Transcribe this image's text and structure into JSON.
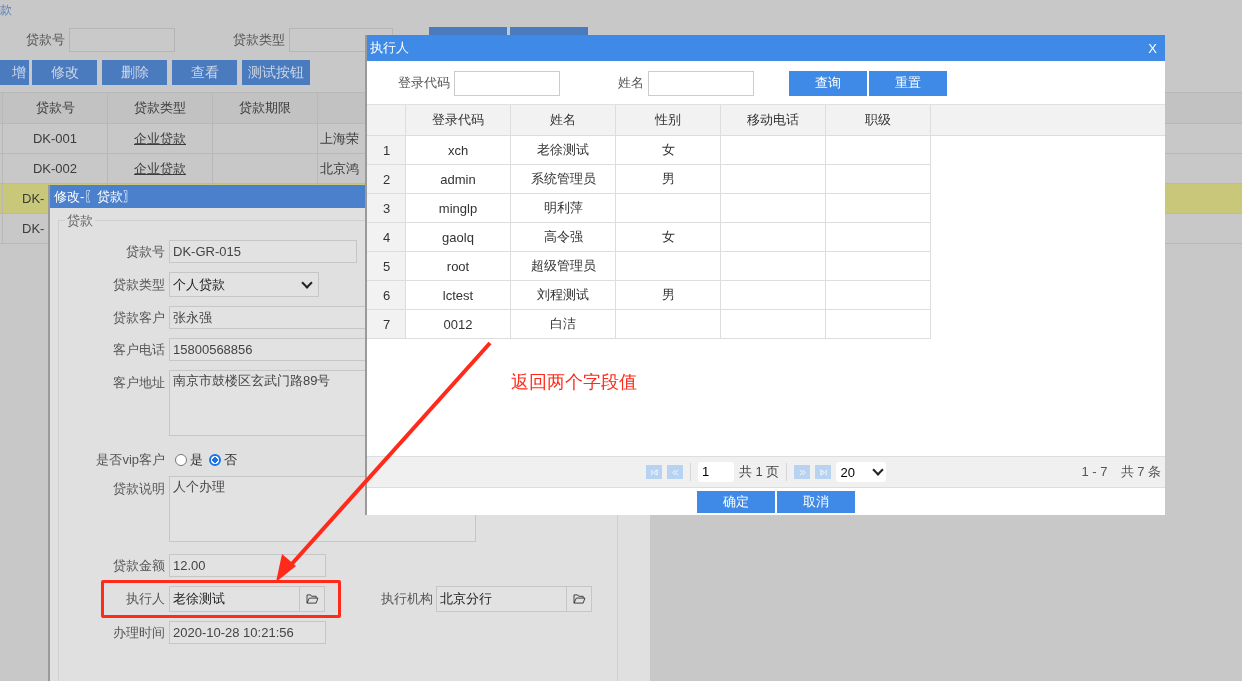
{
  "background_page": {
    "title": "款",
    "search_fields": [
      {
        "label": "贷款号"
      },
      {
        "label": "贷款类型"
      }
    ],
    "toolbar": [
      "增",
      "修改",
      "删除",
      "查看",
      "测试按钮"
    ],
    "table": {
      "columns": [
        "贷款号",
        "贷款类型",
        "贷款期限"
      ],
      "rows": [
        {
          "loan_no": "DK-001",
          "loan_type": "企业贷款",
          "column_4": "上海荣",
          "selected": false
        },
        {
          "loan_no": "DK-002",
          "loan_type": "企业贷款",
          "column_4": "北京鸿",
          "selected": false
        },
        {
          "loan_no": "DK-",
          "selected": true
        },
        {
          "loan_no": "DK-",
          "selected": false
        }
      ]
    }
  },
  "edit_dialog": {
    "title": "修改-〖贷款〗",
    "legend": "贷款",
    "fields": [
      {
        "kind": "text",
        "label": "贷款号",
        "value": "DK-GR-015"
      },
      {
        "kind": "select",
        "label": "贷款类型",
        "value": "个人贷款"
      },
      {
        "kind": "text",
        "label": "贷款客户",
        "value": "张永强"
      },
      {
        "kind": "text",
        "label": "客户电话",
        "value": "15800568856"
      },
      {
        "kind": "textarea",
        "label": "客户地址",
        "value": "南京市鼓楼区玄武门路89号"
      },
      {
        "kind": "radio",
        "label": "是否vip客户",
        "options": [
          {
            "label": "是",
            "selected": false
          },
          {
            "label": "否",
            "selected": true
          }
        ]
      },
      {
        "kind": "textarea",
        "label": "贷款说明",
        "value": "人个办理"
      },
      {
        "kind": "text",
        "label": "贷款金额",
        "value": "12.00"
      },
      {
        "kind": "lookup",
        "label": "执行人",
        "value": "老徐测试",
        "highlighted": true,
        "beside": {
          "label": "执行机构",
          "value": "北京分行"
        }
      },
      {
        "kind": "text",
        "label": "办理时间",
        "value": "2020-10-28 10:21:56"
      }
    ]
  },
  "picker_dialog": {
    "title": "执行人",
    "close": "X",
    "search_fields": [
      {
        "label": "登录代码"
      },
      {
        "label": "姓名"
      }
    ],
    "search_buttons": [
      "查询",
      "重置"
    ],
    "table": {
      "columns": [
        "登录代码",
        "姓名",
        "性别",
        "移动电话",
        "职级"
      ],
      "rows": [
        {
          "index": "1",
          "login": "xch",
          "name": "老徐测试",
          "gender": "女"
        },
        {
          "index": "2",
          "login": "admin",
          "name": "系统管理员",
          "gender": "男"
        },
        {
          "index": "3",
          "login": "minglp",
          "name": "明利萍"
        },
        {
          "index": "4",
          "login": "gaolq",
          "name": "高令强",
          "gender": "女"
        },
        {
          "index": "5",
          "login": "root",
          "name": "超级管理员"
        },
        {
          "index": "6",
          "login": "lctest",
          "name": "刘程测试",
          "gender": "男"
        },
        {
          "index": "7",
          "login": "0012",
          "name": "白洁"
        }
      ]
    },
    "pager": {
      "page": "1",
      "total_pages": "共 1 页",
      "page_size": "20",
      "summary": "1 - 7　共 7 条"
    },
    "buttons": [
      "确定",
      "取消"
    ]
  },
  "annotation": {
    "text": "返回两个字段值"
  }
}
